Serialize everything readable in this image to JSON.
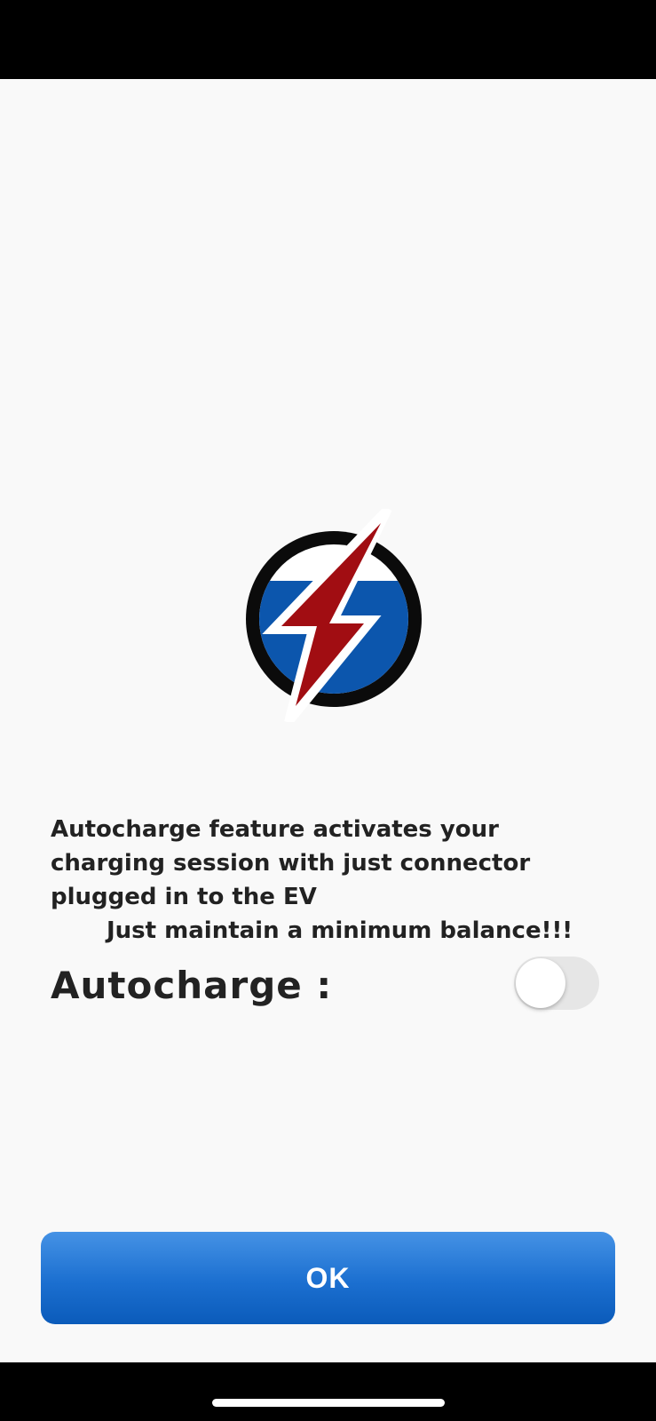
{
  "content": {
    "description": "Autocharge feature activates your charging session with just connector plugged in to the EV",
    "balance_note": "Just maintain a minimum balance!!!",
    "autocharge_label": "Autocharge :",
    "autocharge_enabled": false
  },
  "footer": {
    "ok_label": "OK"
  },
  "colors": {
    "background": "#f9f9f9",
    "button_blue": "#1b6fd0",
    "logo_red": "#a10d12",
    "logo_blue": "#0c56ad",
    "text": "#222222"
  },
  "icons": {
    "logo": "lightning-bolt-logo-icon"
  }
}
